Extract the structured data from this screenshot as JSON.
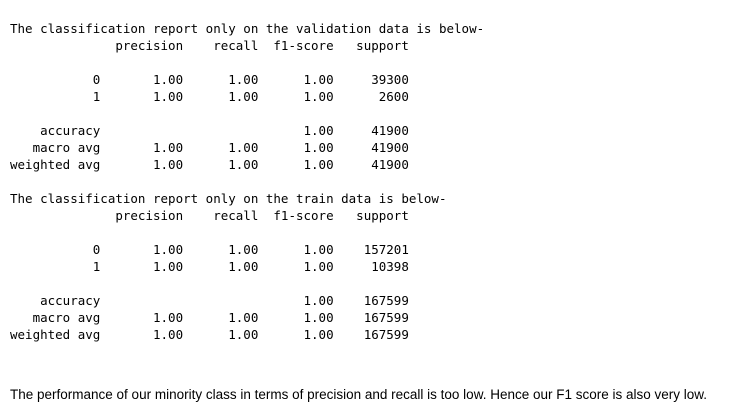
{
  "validation_report": {
    "title": "The classification report only on the validation data is below-",
    "header": "              precision    recall  f1-score   support",
    "rows": [
      "",
      "           0       1.00      1.00      1.00     39300",
      "           1       1.00      1.00      1.00      2600",
      "",
      "    accuracy                           1.00     41900",
      "   macro avg       1.00      1.00      1.00     41900",
      "weighted avg       1.00      1.00      1.00     41900"
    ]
  },
  "train_report": {
    "title": "The classification report only on the train data is below-",
    "header": "              precision    recall  f1-score   support",
    "rows": [
      "",
      "           0       1.00      1.00      1.00    157201",
      "           1       1.00      1.00      1.00     10398",
      "",
      "    accuracy                           1.00    167599",
      "   macro avg       1.00      1.00      1.00    167599",
      "weighted avg       1.00      1.00      1.00    167599"
    ]
  },
  "conclusion": "The performance of our minority class in terms of precision and recall is too low. Hence our F1 score is also very low."
}
